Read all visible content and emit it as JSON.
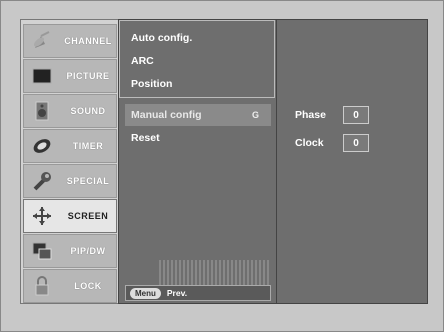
{
  "sidebar": {
    "items": [
      {
        "label": "CHANNEL",
        "icon": "satellite-dish-icon"
      },
      {
        "label": "PICTURE",
        "icon": "tv-screen-icon"
      },
      {
        "label": "SOUND",
        "icon": "speaker-icon"
      },
      {
        "label": "TIMER",
        "icon": "clock-icon"
      },
      {
        "label": "SPECIAL",
        "icon": "wrench-icon"
      },
      {
        "label": "SCREEN",
        "icon": "move-arrows-icon"
      },
      {
        "label": "PIP/DW",
        "icon": "pip-windows-icon"
      },
      {
        "label": "LOCK",
        "icon": "lock-icon"
      }
    ],
    "active_index": 5
  },
  "submenu": {
    "items": [
      {
        "label": "Auto config."
      },
      {
        "label": "ARC"
      },
      {
        "label": "Position"
      },
      {
        "label": "Manual config",
        "hint": "G"
      },
      {
        "label": "Reset"
      }
    ],
    "selected_index": 3,
    "menu_button": "Menu",
    "prev_label": "Prev."
  },
  "detail": {
    "phase_label": "Phase",
    "phase_value": "0",
    "clock_label": "Clock",
    "clock_value": "0"
  }
}
